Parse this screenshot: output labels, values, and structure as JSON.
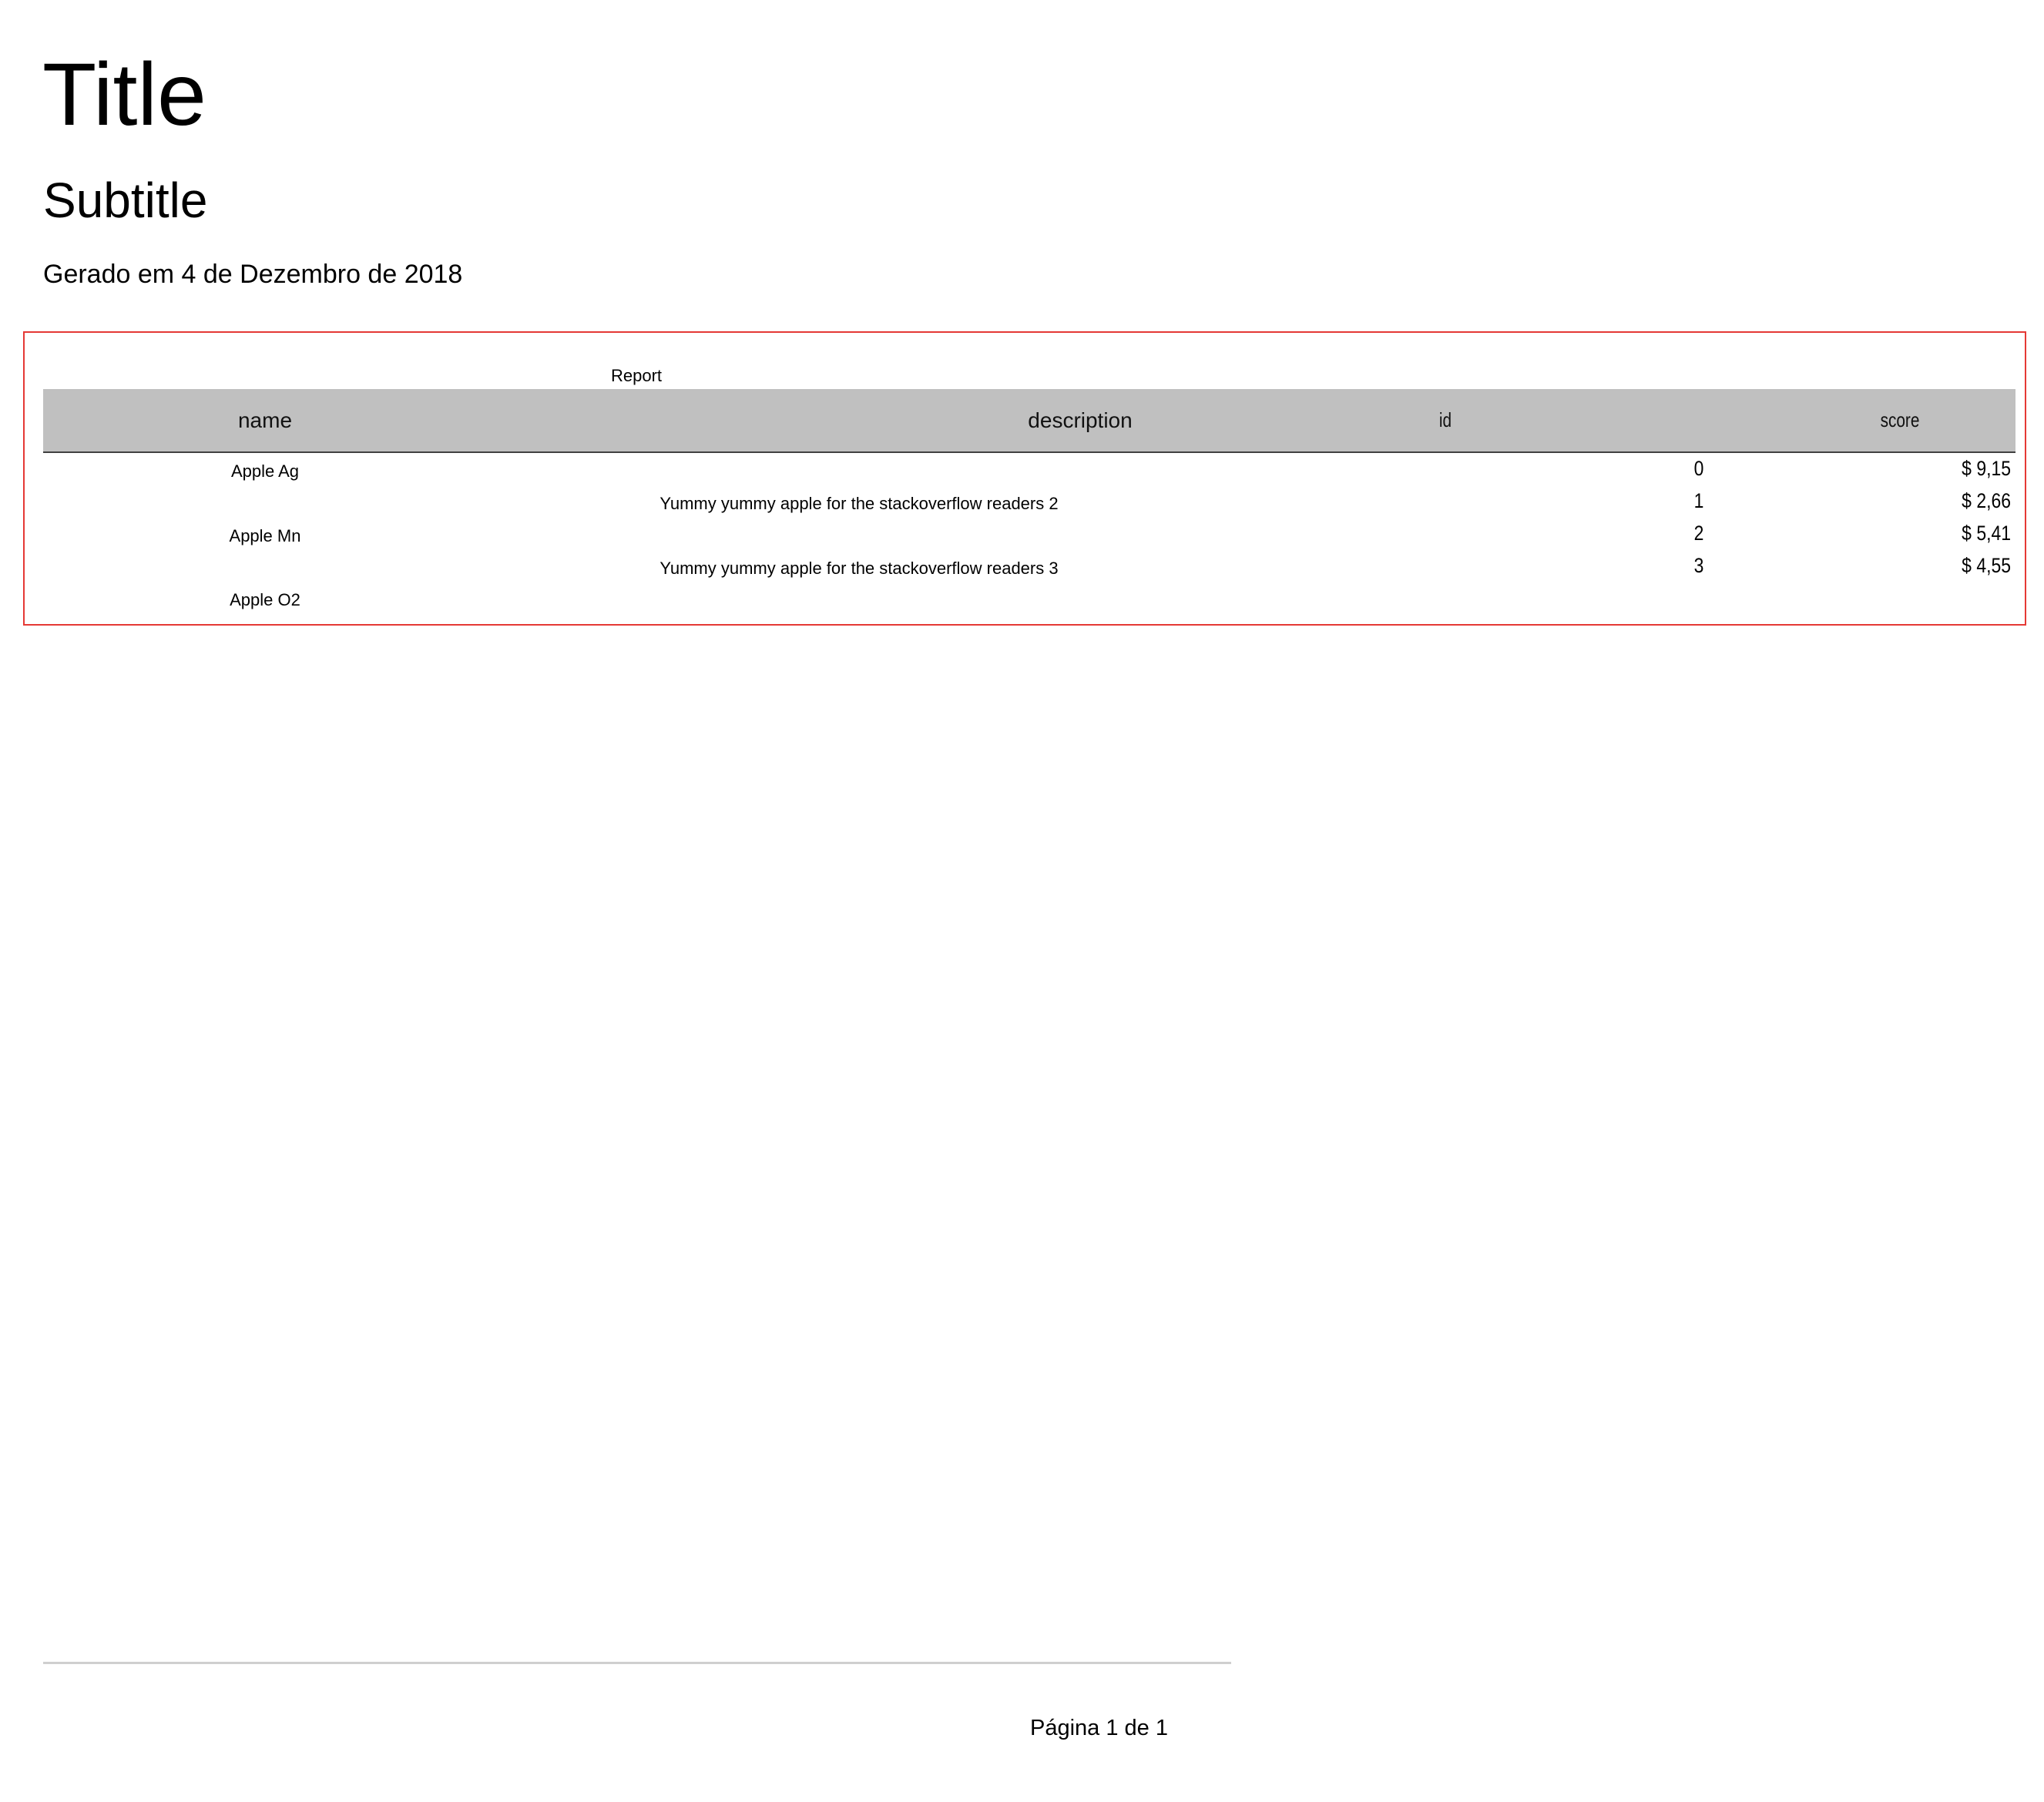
{
  "title": "Title",
  "subtitle": "Subtitle",
  "generated": "Gerado em 4 de Dezembro de 2018",
  "report": {
    "label": "Report",
    "columns": {
      "name": "name",
      "description": "description",
      "id": "id",
      "score": "score"
    },
    "names": [
      "Apple Ag",
      "Apple Mn",
      "Apple O2"
    ],
    "descriptions": [
      "Yummy yummy apple for the stackoverflow readers 2",
      "Yummy yummy apple for the stackoverflow readers 3"
    ],
    "ids": [
      "0",
      "1",
      "2",
      "3"
    ],
    "scores": [
      "$ 9,15",
      "$ 2,66",
      "$ 5,41",
      "$ 4,55"
    ]
  },
  "footer": {
    "page": "Página 1 de 1"
  }
}
